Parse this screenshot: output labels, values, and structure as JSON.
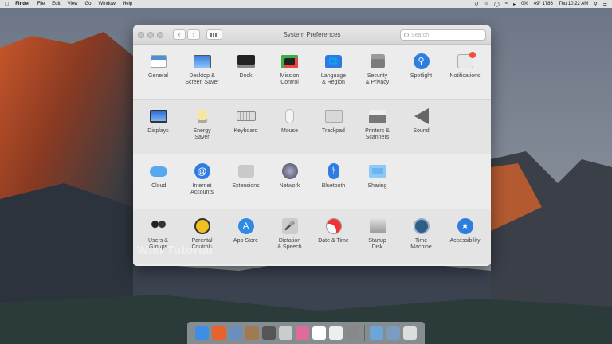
{
  "menubar": {
    "app": "Finder",
    "items": [
      "File",
      "Edit",
      "View",
      "Go",
      "Window",
      "Help"
    ],
    "status": {
      "battery": "0%",
      "temp": "49° 1786",
      "clock": "Thu 10:22 AM"
    }
  },
  "window": {
    "title": "System Preferences",
    "search_placeholder": "Search",
    "sections": [
      [
        {
          "label": "General",
          "icon": "general-icon"
        },
        {
          "label": "Desktop &\nScreen Saver",
          "icon": "desktop-icon"
        },
        {
          "label": "Dock",
          "icon": "dock-icon"
        },
        {
          "label": "Mission\nControl",
          "icon": "mission-control-icon"
        },
        {
          "label": "Language\n& Region",
          "icon": "language-icon"
        },
        {
          "label": "Security\n& Privacy",
          "icon": "security-icon"
        },
        {
          "label": "Spotlight",
          "icon": "spotlight-icon"
        },
        {
          "label": "Notifications",
          "icon": "notifications-icon"
        }
      ],
      [
        {
          "label": "Displays",
          "icon": "displays-icon"
        },
        {
          "label": "Energy\nSaver",
          "icon": "energy-icon"
        },
        {
          "label": "Keyboard",
          "icon": "keyboard-icon"
        },
        {
          "label": "Mouse",
          "icon": "mouse-icon"
        },
        {
          "label": "Trackpad",
          "icon": "trackpad-icon"
        },
        {
          "label": "Printers &\nScanners",
          "icon": "printer-icon"
        },
        {
          "label": "Sound",
          "icon": "sound-icon"
        }
      ],
      [
        {
          "label": "iCloud",
          "icon": "icloud-icon"
        },
        {
          "label": "Internet\nAccounts",
          "icon": "internet-accounts-icon"
        },
        {
          "label": "Extensions",
          "icon": "extensions-icon"
        },
        {
          "label": "Network",
          "icon": "network-icon"
        },
        {
          "label": "Bluetooth",
          "icon": "bluetooth-icon"
        },
        {
          "label": "Sharing",
          "icon": "sharing-icon"
        }
      ],
      [
        {
          "label": "Users &\nGroups",
          "icon": "users-icon"
        },
        {
          "label": "Parental\nControls",
          "icon": "parental-icon"
        },
        {
          "label": "App Store",
          "icon": "appstore-icon"
        },
        {
          "label": "Dictation\n& Speech",
          "icon": "dictation-icon"
        },
        {
          "label": "Date & Time",
          "icon": "datetime-icon"
        },
        {
          "label": "Startup\nDisk",
          "icon": "startup-disk-icon"
        },
        {
          "label": "Time\nMachine",
          "icon": "time-machine-icon"
        },
        {
          "label": "Accessibility",
          "icon": "accessibility-icon"
        }
      ]
    ]
  },
  "watermark": "Wiki Tutorial",
  "dock": [
    "finder-icon",
    "firefox-icon",
    "preview-icon",
    "contacts-icon",
    "launchpad-icon",
    "photos-icon",
    "itunes-icon",
    "calendar-icon",
    "textedit-icon",
    "system-prefs-icon",
    "folder-icon",
    "downloads-icon",
    "trash-icon"
  ]
}
